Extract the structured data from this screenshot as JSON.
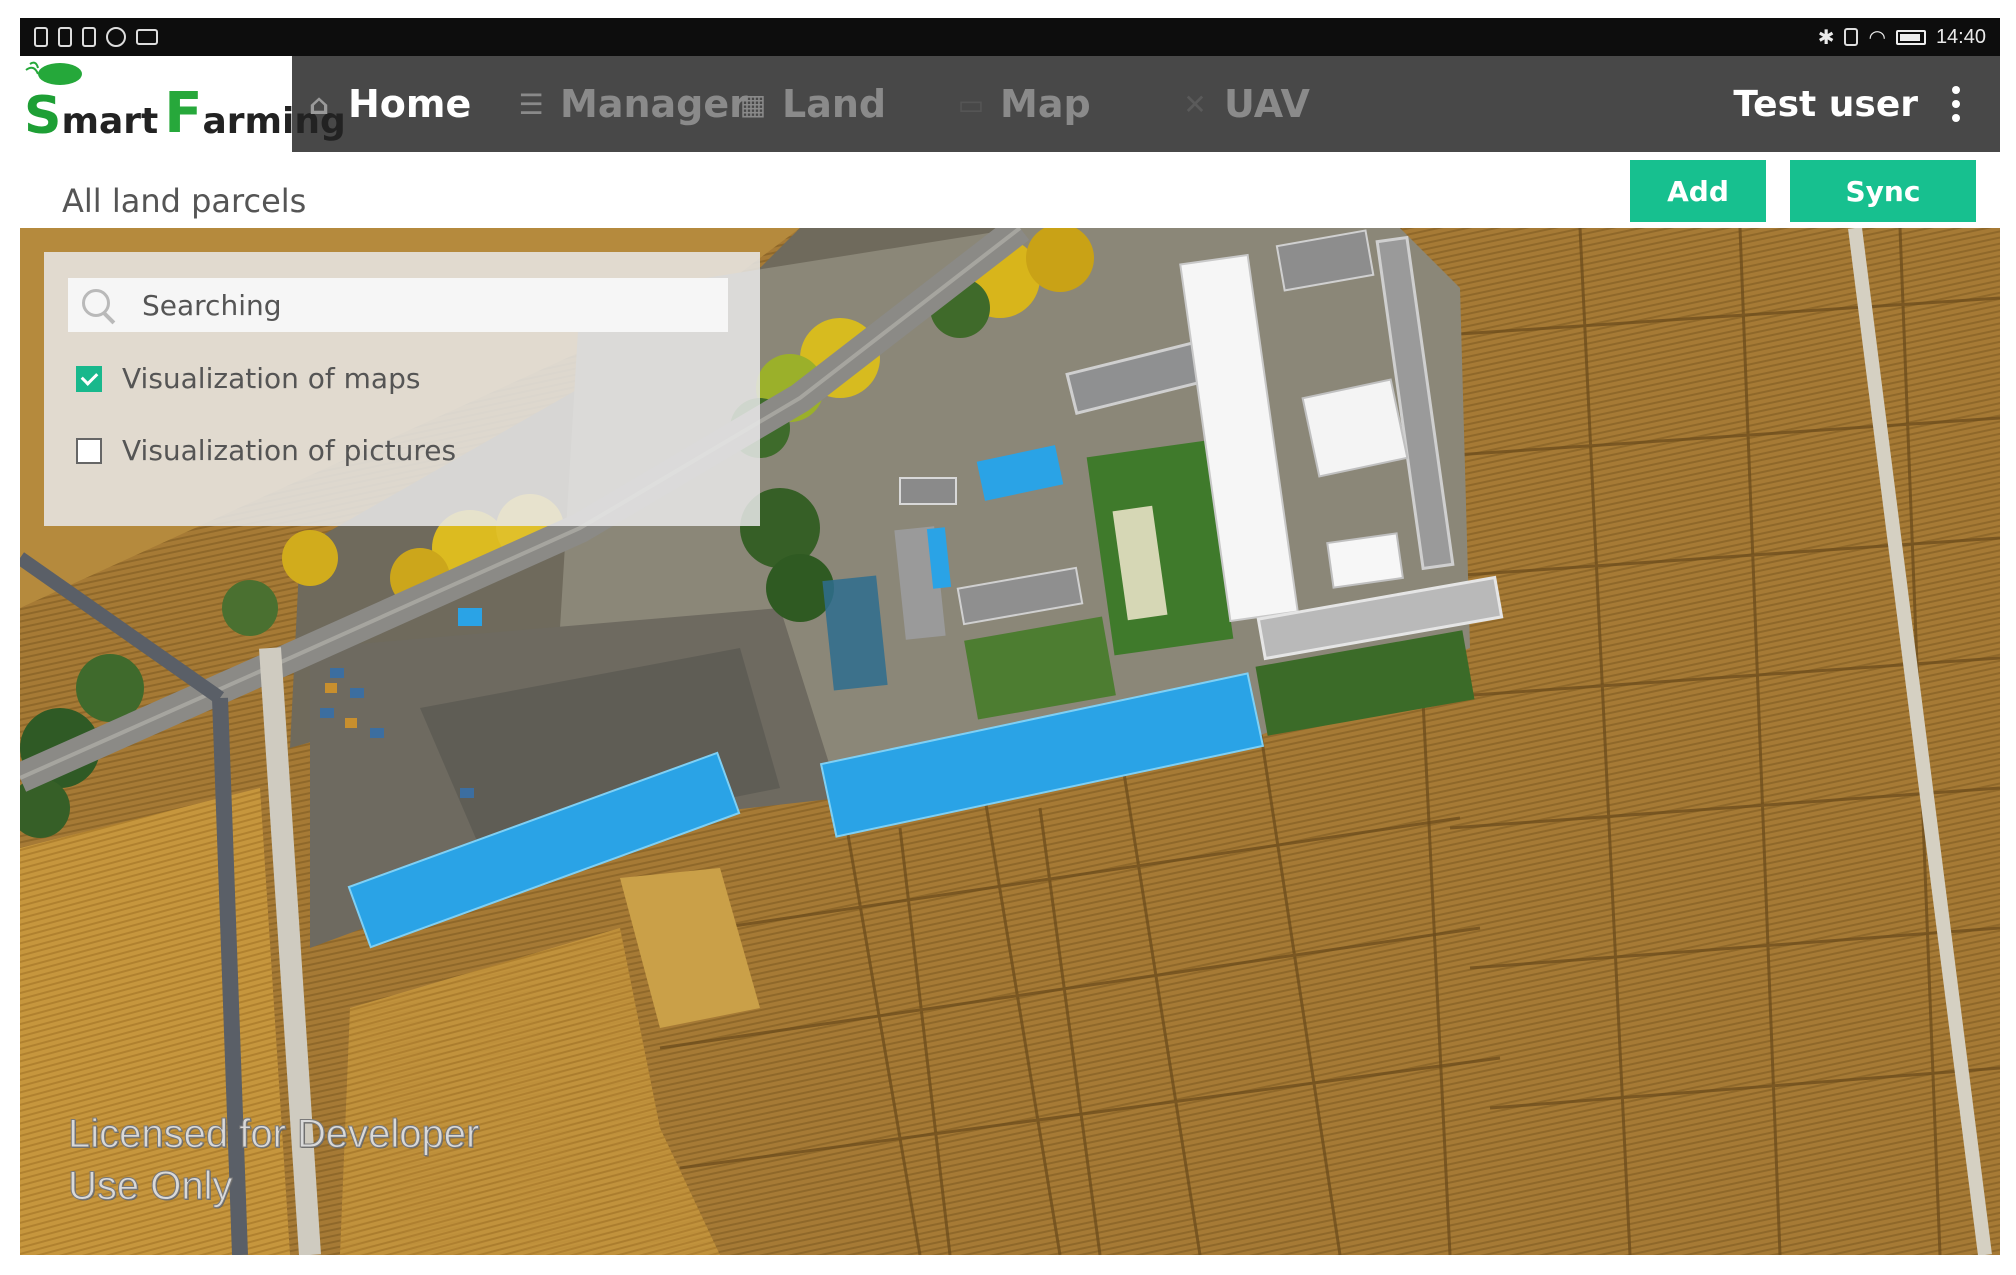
{
  "status_bar": {
    "left_icons": [
      "sim-icon",
      "notification-icon",
      "notification-icon",
      "clock-icon",
      "keyboard-icon"
    ],
    "right_icons": [
      "bluetooth-icon",
      "vibrate-icon",
      "wifi-icon",
      "battery-icon"
    ],
    "time": "14:40"
  },
  "app": {
    "logo_s": "S",
    "logo_mart": "mart",
    "logo_f": "F",
    "logo_arming": "arming"
  },
  "nav": {
    "items": [
      {
        "label": "Home",
        "icon": "home-icon",
        "active": true
      },
      {
        "label": "Manager",
        "icon": "list-icon",
        "active": false
      },
      {
        "label": "Land",
        "icon": "land-icon",
        "active": false
      },
      {
        "label": "Map",
        "icon": "map-icon",
        "active": false
      },
      {
        "label": "UAV",
        "icon": "drone-icon",
        "active": false
      }
    ],
    "user": "Test user",
    "menu_icon": "more-vertical-icon"
  },
  "page": {
    "title": "All land parcels",
    "add_label": "Add",
    "sync_label": "Sync"
  },
  "panel": {
    "search_placeholder": "Searching",
    "options": [
      {
        "label": "Visualization of maps",
        "checked": true
      },
      {
        "label": "Visualization of pictures",
        "checked": false
      }
    ]
  },
  "map": {
    "watermark_line1": "Licensed for Developer",
    "watermark_line2": "Use Only"
  },
  "colors": {
    "nav_bg": "#484848",
    "accent": "#17c08f",
    "field": "#9c7330",
    "roof_blue": "#2aa3e6"
  }
}
